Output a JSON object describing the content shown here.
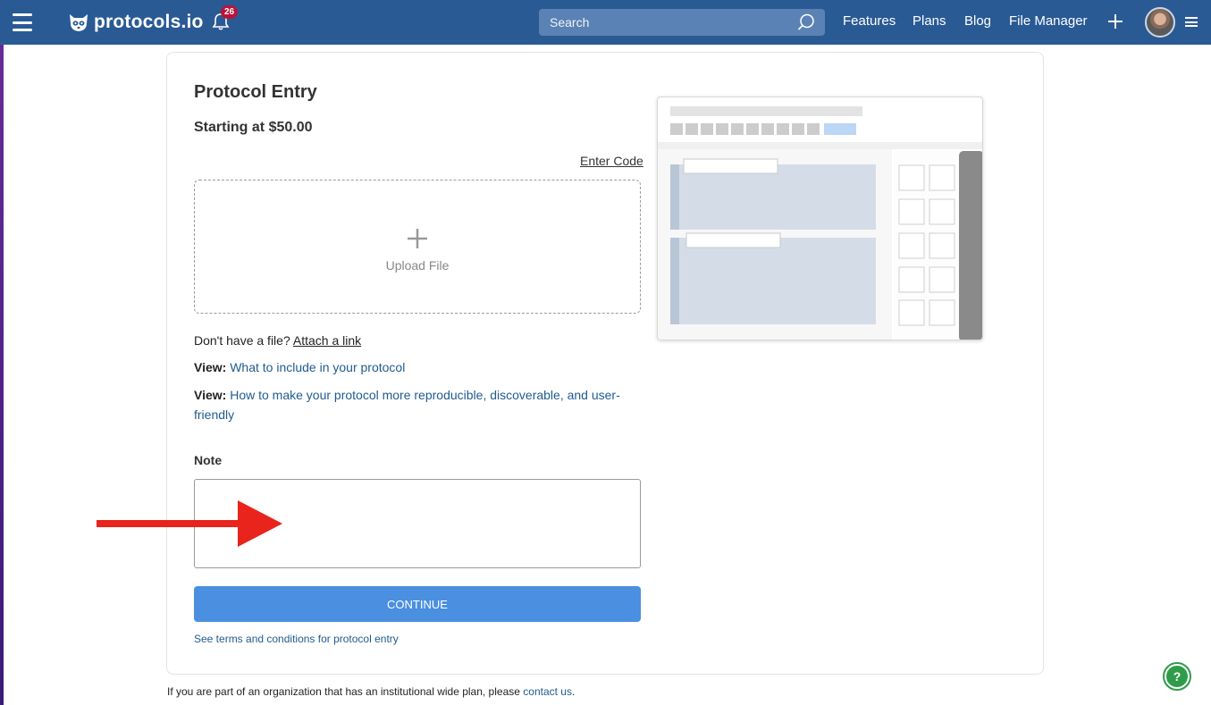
{
  "nav": {
    "logo_text": "protocols.io",
    "notification_count": "26",
    "search_placeholder": "Search",
    "links": [
      "Features",
      "Plans",
      "Blog",
      "File Manager"
    ]
  },
  "entry": {
    "title": "Protocol Entry",
    "price": "Starting at $50.00",
    "enter_code": "Enter Code",
    "upload_label": "Upload File",
    "no_file_text": "Don't have a file?",
    "attach_link": "Attach a link",
    "view_prefix": "View:",
    "view_link_1": "What to include in your protocol",
    "view_link_2": "How to make your protocol more reproducible, discoverable, and user-friendly",
    "note_label": "Note",
    "continue_label": "CONTINUE",
    "terms_link": "See terms and conditions for protocol entry"
  },
  "footer": {
    "text": "If you are part of an organization that has an institutional wide plan, please ",
    "contact_link": "contact us",
    "end": "."
  },
  "help": {
    "label": "?"
  },
  "colors": {
    "nav_bg": "#2a5a94",
    "continue_bg": "#4a8fe0",
    "link": "#1f5b8f",
    "arrow": "#e8241c",
    "help": "#2f9c4a"
  }
}
